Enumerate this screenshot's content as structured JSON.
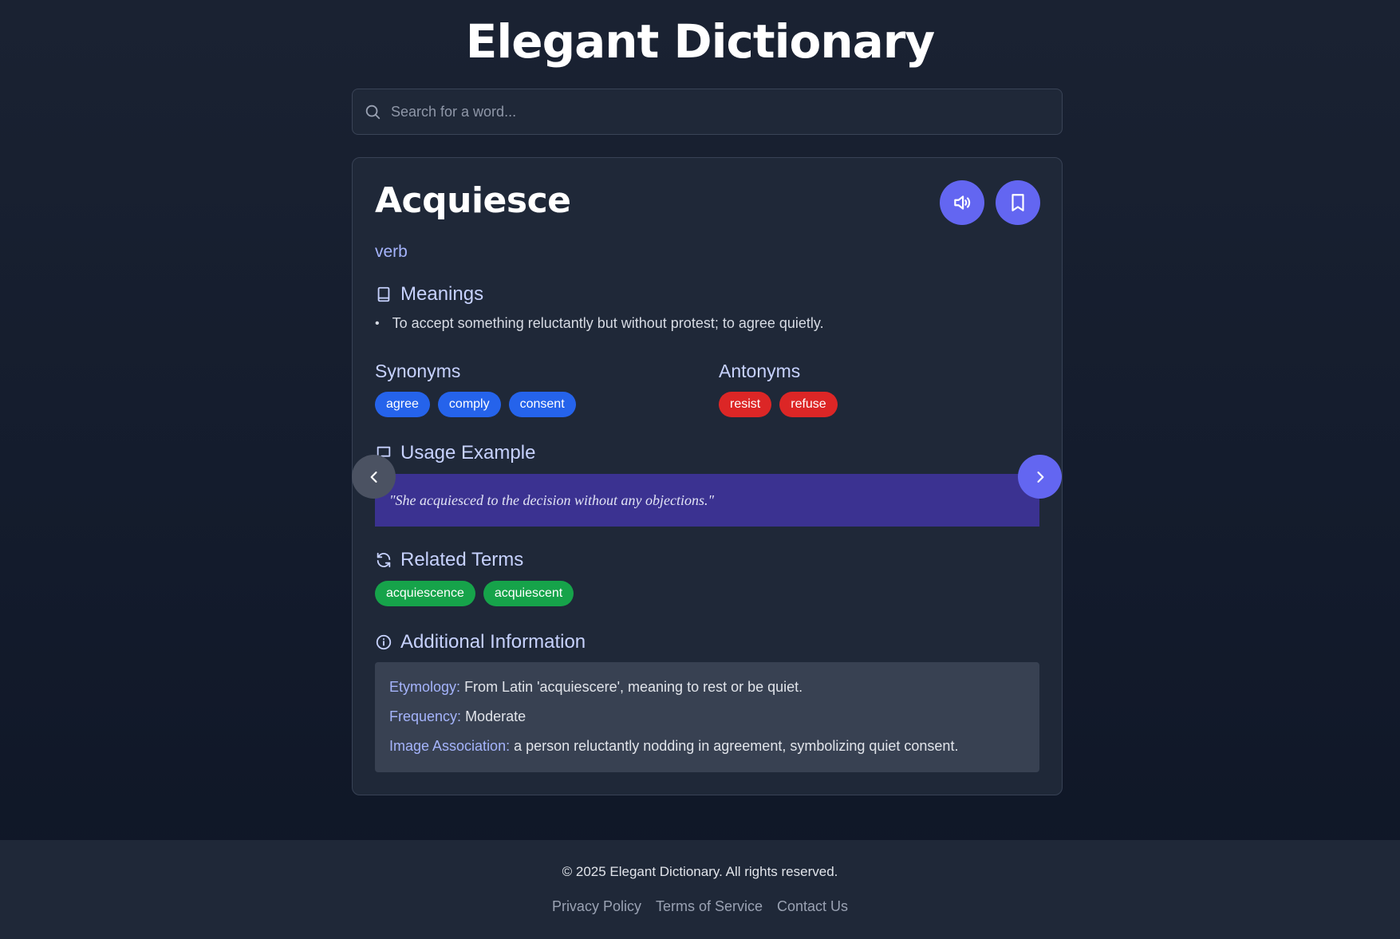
{
  "app": {
    "title": "Elegant Dictionary"
  },
  "search": {
    "placeholder": "Search for a word...",
    "value": ""
  },
  "entry": {
    "word": "Acquiesce",
    "part_of_speech": "verb",
    "meanings_title": "Meanings",
    "meanings": [
      "To accept something reluctantly but without protest; to agree quietly."
    ],
    "synonyms_title": "Synonyms",
    "synonyms": [
      "agree",
      "comply",
      "consent"
    ],
    "antonyms_title": "Antonyms",
    "antonyms": [
      "resist",
      "refuse"
    ],
    "usage_title": "Usage Example",
    "usage_example": "\"She acquiesced to the decision without any objections.\"",
    "related_title": "Related Terms",
    "related_terms": [
      "acquiescence",
      "acquiescent"
    ],
    "additional_title": "Additional Information",
    "additional": {
      "etymology_label": "Etymology:",
      "etymology_value": "From Latin 'acquiescere', meaning to rest or be quiet.",
      "frequency_label": "Frequency:",
      "frequency_value": "Moderate",
      "image_label": "Image Association:",
      "image_value": "a person reluctantly nodding in agreement, symbolizing quiet consent."
    }
  },
  "footer": {
    "copyright": "© 2025 Elegant Dictionary. All rights reserved.",
    "links": [
      "Privacy Policy",
      "Terms of Service",
      "Contact Us"
    ]
  },
  "icons": {
    "search": "search-icon",
    "speaker": "speaker-icon",
    "bookmark": "bookmark-icon",
    "book": "book-icon",
    "message": "message-square-icon",
    "refresh": "refresh-icon",
    "info": "info-icon",
    "chevron_left": "chevron-left-icon",
    "chevron_right": "chevron-right-icon"
  },
  "colors": {
    "accent": "#6366f1",
    "synonym_chip": "#2563eb",
    "antonym_chip": "#dc2626",
    "related_chip": "#16a34a",
    "example_bg": "#3b3291"
  }
}
